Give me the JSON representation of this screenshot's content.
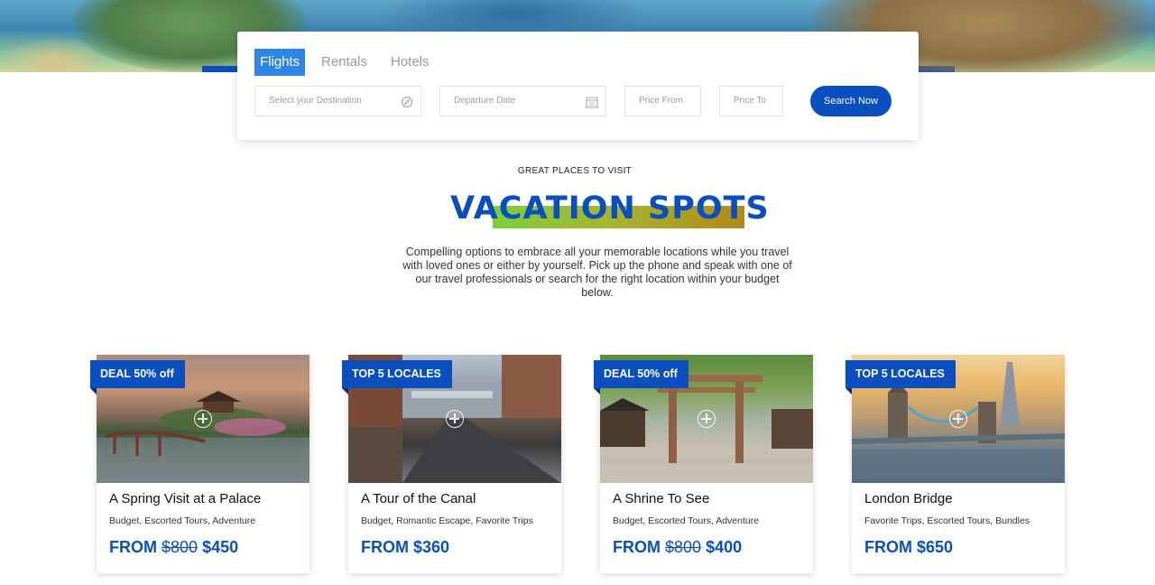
{
  "search": {
    "tabs": [
      "Flights",
      "Rentals",
      "Hotels"
    ],
    "destination_placeholder": "Select your Destination",
    "date_placeholder": "Departure Date",
    "price_from_placeholder": "Price From",
    "price_to_placeholder": "Price To",
    "button_label": "Search Now"
  },
  "section": {
    "kicker": "GREAT PLACES TO VISIT",
    "title": "VACATION SPOTS",
    "intro": "Compelling options to embrace all your memorable locations while you travel with loved ones or either by yourself. Pick up the phone and speak with one of our travel professionals or search for the right location within your budget below."
  },
  "cards": [
    {
      "badge": "DEAL 50% off",
      "name": "A Spring Visit at a Palace",
      "categories": "Budget, Escorted Tours, Adventure",
      "price_prefix": "FROM",
      "old_price": "$800",
      "price": "$450"
    },
    {
      "badge": "TOP 5 LOCALES",
      "name": "A Tour of the Canal",
      "categories": "Budget, Romantic Escape, Favorite Trips",
      "price_prefix": "FROM",
      "old_price": "",
      "price": "$360"
    },
    {
      "badge": "DEAL 50% off",
      "name": "A Shrine To See",
      "categories": "Budget, Escorted Tours, Adventure",
      "price_prefix": "FROM",
      "old_price": "$800",
      "price": "$400"
    },
    {
      "badge": "TOP 5 LOCALES",
      "name": "London Bridge",
      "categories": "Favorite Trips, Escorted Tours, Bundles",
      "price_prefix": "FROM",
      "old_price": "",
      "price": "$650"
    }
  ],
  "colors": {
    "brand_blue": "#0a4fbf",
    "active_tab": "#2f86e6"
  },
  "icons": {
    "destination": "compass-icon",
    "date": "calendar-icon",
    "card_overlay": "plus-circle-icon"
  }
}
